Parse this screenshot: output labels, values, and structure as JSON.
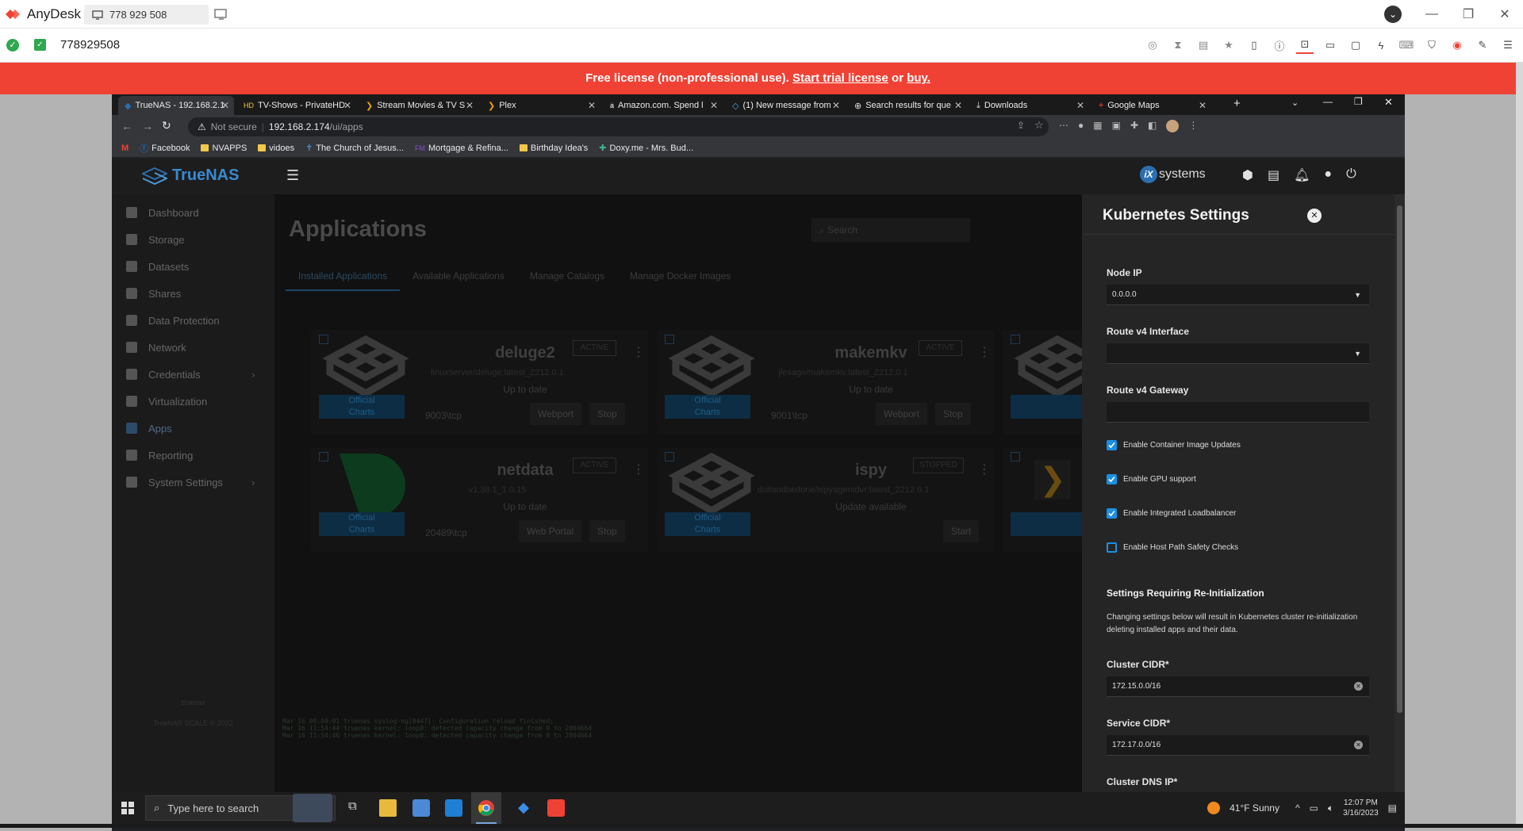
{
  "anydesk": {
    "app_name": "AnyDesk",
    "tab_label": "778 929 508",
    "remote_id": "778929508",
    "banner": {
      "prefix": "Free license (non-professional use).",
      "trial_link": "Start trial license",
      "or": "or",
      "buy_link": "buy."
    }
  },
  "chrome": {
    "tabs": [
      {
        "label": "TrueNAS - 192.168.2.1"
      },
      {
        "label": "TV-Shows - PrivateHD"
      },
      {
        "label": "Stream Movies & TV S"
      },
      {
        "label": "Plex"
      },
      {
        "label": "Amazon.com. Spend l"
      },
      {
        "label": "(1) New message from"
      },
      {
        "label": "Search results for que"
      },
      {
        "label": "Downloads"
      },
      {
        "label": "Google Maps"
      }
    ],
    "security_label": "Not secure",
    "url_host": "192.168.2.174",
    "url_path": "/ui/apps",
    "bookmarks": [
      {
        "label": "Facebook"
      },
      {
        "label": "NVAPPS"
      },
      {
        "label": "vidoes"
      },
      {
        "label": "The Church of Jesus..."
      },
      {
        "label": "Mortgage & Refina..."
      },
      {
        "label": "Birthday Idea's"
      },
      {
        "label": "Doxy.me - Mrs. Bud..."
      }
    ]
  },
  "truenas": {
    "logo_text": "TrueNAS",
    "logo_sub": "SCALE",
    "vendor": "systems",
    "sidebar": [
      {
        "label": "Dashboard"
      },
      {
        "label": "Storage"
      },
      {
        "label": "Datasets"
      },
      {
        "label": "Shares"
      },
      {
        "label": "Data Protection"
      },
      {
        "label": "Network"
      },
      {
        "label": "Credentials"
      },
      {
        "label": "Virtualization"
      },
      {
        "label": "Apps"
      },
      {
        "label": "Reporting"
      },
      {
        "label": "System Settings"
      }
    ],
    "sidebar_footer": {
      "host": "truenas",
      "version": "TrueNAS SCALE ® 2022"
    },
    "page_title": "Applications",
    "search_placeholder": "Search",
    "tabs": [
      "Installed Applications",
      "Available Applications",
      "Manage Catalogs",
      "Manage Docker Images"
    ],
    "apps": [
      {
        "name": "deluge2",
        "image": "linuxserver/deluge:latest_2212.0.1",
        "status": "ACTIVE",
        "update": "Up to date",
        "port": "9003\\tcp",
        "badge": "Official",
        "badge2": "Charts",
        "buttons": [
          "Webport",
          "Stop"
        ]
      },
      {
        "name": "makemkv",
        "image": "jlesage/makemkv:latest_2212.0.1",
        "status": "ACTIVE",
        "update": "Up to date",
        "port": "9001\\tcp",
        "badge": "Official",
        "badge2": "Charts",
        "buttons": [
          "Webport",
          "Stop"
        ]
      },
      {
        "name": "netdata",
        "image": "v1.38.1_1.0.15",
        "status": "ACTIVE",
        "update": "Up to date",
        "port": "20489\\tcp",
        "badge": "Official",
        "badge2": "Charts",
        "buttons": [
          "Web Portal",
          "Stop"
        ]
      },
      {
        "name": "ispy",
        "image": "doitandbedone/ispyagentdvr:latest_2212.0.1",
        "status": "STOPPED",
        "update": "Update available",
        "port": "",
        "badge": "Official",
        "badge2": "Charts",
        "buttons": [
          "Start"
        ]
      }
    ],
    "log_lines": [
      "Mar 16 00:00:01 truenas syslog-ng[8447]: Configuration reload finished;",
      "Mar 16 11:54:44 truenas kernel: loop0: detected capacity change from 0 to 2804664",
      "Mar 16 11:54:46 truenas kernel: loop0: detected capacity change from 0 to 2804664"
    ]
  },
  "kubernetes": {
    "title": "Kubernetes Settings",
    "node_ip_label": "Node IP",
    "node_ip_value": "0.0.0.0",
    "route_iface_label": "Route v4 Interface",
    "route_iface_value": "",
    "route_gateway_label": "Route v4 Gateway",
    "route_gateway_value": "",
    "checkboxes": [
      {
        "label": "Enable Container Image Updates",
        "checked": true
      },
      {
        "label": "Enable GPU support",
        "checked": true
      },
      {
        "label": "Enable Integrated Loadbalancer",
        "checked": true
      },
      {
        "label": "Enable Host Path Safety Checks",
        "checked": false
      }
    ],
    "reinit_title": "Settings Requiring Re-Initialization",
    "reinit_desc": "Changing settings below will result in Kubernetes cluster re-initialization deleting installed apps and their data.",
    "cluster_cidr_label": "Cluster CIDR*",
    "cluster_cidr_value": "172.15.0.0/16",
    "service_cidr_label": "Service CIDR*",
    "service_cidr_value": "172.17.0.0/16",
    "cluster_dns_label": "Cluster DNS IP*"
  },
  "taskbar": {
    "search_placeholder": "Type here to search",
    "weather": "41°F  Sunny",
    "time": "12:07 PM",
    "date": "3/16/2023"
  },
  "colors": {
    "anydesk_red": "#ef4235",
    "accent_blue": "#1b8fe3",
    "truenas_blue": "#2b6fb0"
  }
}
